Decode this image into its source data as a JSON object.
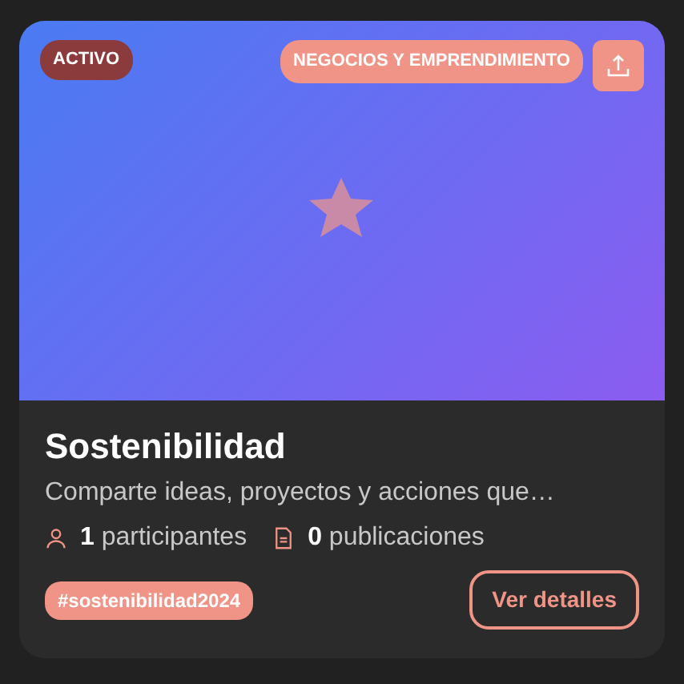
{
  "status_badge": "ACTIVO",
  "category_badge": "NEGOCIOS Y EMPRENDIMIENTO",
  "title": "Sostenibilidad",
  "description": "Comparte ideas, proyectos y acciones que…",
  "stats": [
    {
      "kind": "participants",
      "text": "**1** participantes"
    },
    {
      "kind": "posts",
      "text": "**0** publicaciones"
    }
  ],
  "hashtag": "#sostenibilidad2024",
  "button": "Ver detalles"
}
